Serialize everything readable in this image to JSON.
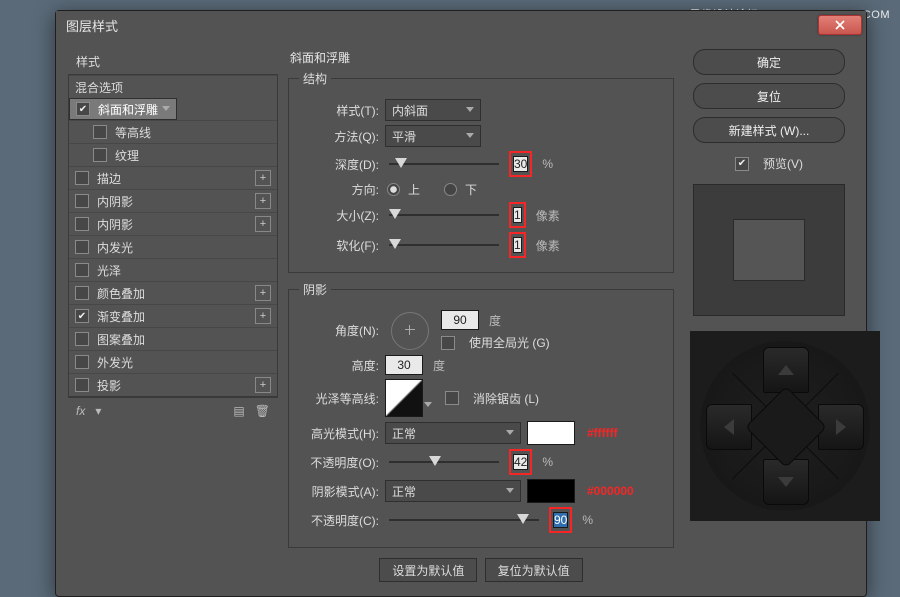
{
  "watermark": "思缘设计论坛  WWW.MISSYUAN.COM",
  "window_title": "图层样式",
  "left": {
    "header": "样式",
    "blend_header": "混合选项",
    "items": [
      {
        "label": "斜面和浮雕",
        "checked": true,
        "selected": true,
        "plus": false,
        "child": false
      },
      {
        "label": "等高线",
        "checked": false,
        "selected": false,
        "plus": false,
        "child": true
      },
      {
        "label": "纹理",
        "checked": false,
        "selected": false,
        "plus": false,
        "child": true
      },
      {
        "label": "描边",
        "checked": false,
        "selected": false,
        "plus": true,
        "child": false
      },
      {
        "label": "内阴影",
        "checked": false,
        "selected": false,
        "plus": true,
        "child": false
      },
      {
        "label": "内阴影",
        "checked": false,
        "selected": false,
        "plus": true,
        "child": false
      },
      {
        "label": "内发光",
        "checked": false,
        "selected": false,
        "plus": false,
        "child": false
      },
      {
        "label": "光泽",
        "checked": false,
        "selected": false,
        "plus": false,
        "child": false
      },
      {
        "label": "颜色叠加",
        "checked": false,
        "selected": false,
        "plus": true,
        "child": false
      },
      {
        "label": "渐变叠加",
        "checked": true,
        "selected": false,
        "plus": true,
        "child": false
      },
      {
        "label": "图案叠加",
        "checked": false,
        "selected": false,
        "plus": false,
        "child": false
      },
      {
        "label": "外发光",
        "checked": false,
        "selected": false,
        "plus": false,
        "child": false
      },
      {
        "label": "投影",
        "checked": false,
        "selected": false,
        "plus": true,
        "child": false
      }
    ]
  },
  "section_title": "斜面和浮雕",
  "structure": {
    "legend": "结构",
    "style_label": "样式(T):",
    "style_value": "内斜面",
    "method_label": "方法(Q):",
    "method_value": "平滑",
    "depth_label": "深度(D):",
    "depth_value": "30",
    "depth_unit": "%",
    "dir_label": "方向:",
    "dir_up": "上",
    "dir_down": "下",
    "size_label": "大小(Z):",
    "size_value": "1",
    "size_unit": "像素",
    "soften_label": "软化(F):",
    "soften_value": "1",
    "soften_unit": "像素"
  },
  "shading": {
    "legend": "阴影",
    "angle_label": "角度(N):",
    "angle_value": "90",
    "angle_unit": "度",
    "global_label": "使用全局光 (G)",
    "altitude_label": "高度:",
    "altitude_value": "30",
    "altitude_unit": "度",
    "gloss_label": "光泽等高线:",
    "antialias_label": "消除锯齿 (L)",
    "hl_mode_label": "高光模式(H):",
    "hl_mode_value": "正常",
    "hl_hex": "#ffffff",
    "hl_op_label": "不透明度(O):",
    "hl_op_value": "42",
    "pct": "%",
    "sh_mode_label": "阴影模式(A):",
    "sh_mode_value": "正常",
    "sh_hex": "#000000",
    "sh_op_label": "不透明度(C):",
    "sh_op_value": "90"
  },
  "bottom_buttons": {
    "default": "设置为默认值",
    "reset": "复位为默认值"
  },
  "right": {
    "ok": "确定",
    "cancel": "复位",
    "new_style": "新建样式 (W)...",
    "preview_label": "预览(V)"
  }
}
